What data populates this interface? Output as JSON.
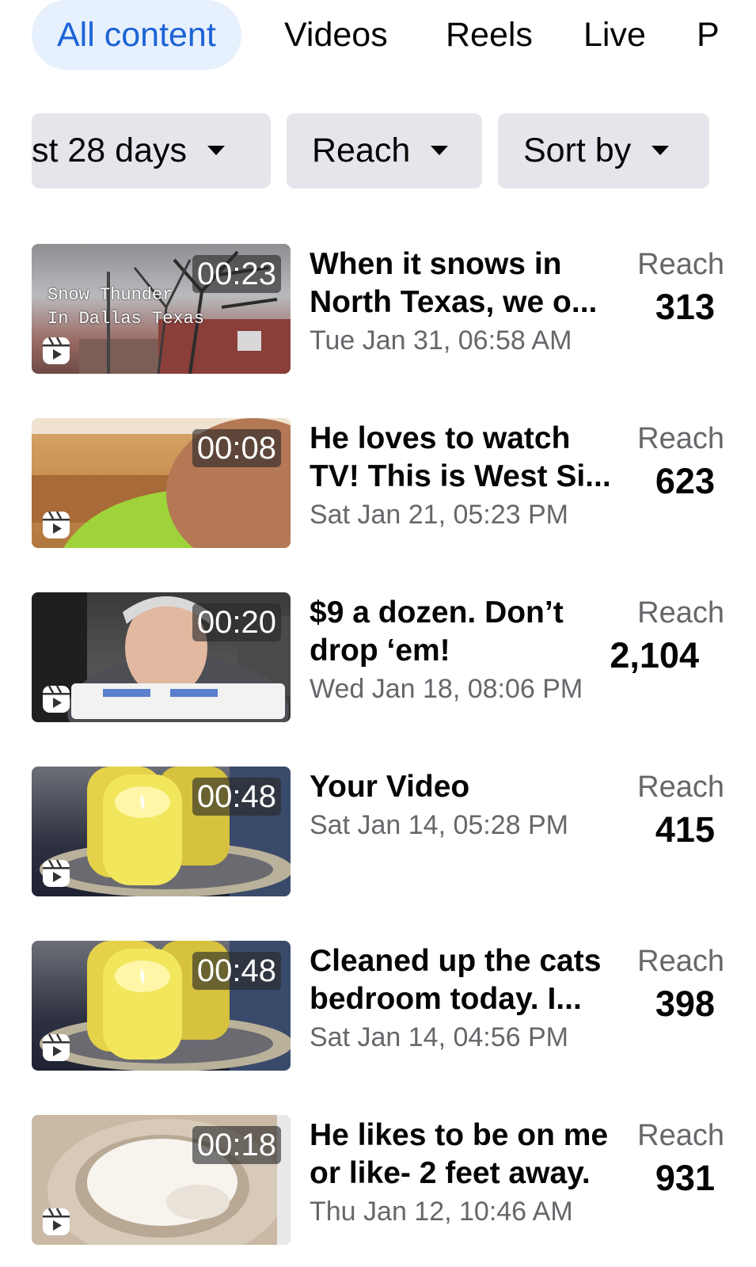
{
  "tabs": [
    {
      "label": "All content",
      "active": true
    },
    {
      "label": "Videos"
    },
    {
      "label": "Reels"
    },
    {
      "label": "Live"
    },
    {
      "label": "P"
    }
  ],
  "filters": [
    {
      "label": "st 28 days"
    },
    {
      "label": "Reach"
    },
    {
      "label": "Sort by"
    }
  ],
  "items": [
    {
      "duration": "00:23",
      "overlay": "Snow Thunder\nIn Dallas Texas",
      "title_line1": "When it snows in",
      "title_line2": "North Texas, we o...",
      "date": "Tue Jan 31, 06:58 AM",
      "metric_label": "Reach",
      "metric_value": "313"
    },
    {
      "duration": "00:08",
      "title_line1": "He loves to watch",
      "title_line2": "TV! This is West Si...",
      "date": "Sat Jan 21, 05:23 PM",
      "metric_label": "Reach",
      "metric_value": "623"
    },
    {
      "duration": "00:20",
      "title_line1": "$9 a dozen. Don’t",
      "title_line2": "drop ‘em!",
      "date": "Wed Jan 18, 08:06 PM",
      "metric_label": "Reach",
      "metric_value": "2,104"
    },
    {
      "duration": "00:48",
      "title_line1": "Your Video",
      "title_line2": "",
      "date": "Sat Jan 14, 05:28 PM",
      "metric_label": "Reach",
      "metric_value": "415"
    },
    {
      "duration": "00:48",
      "title_line1": "Cleaned up the cats",
      "title_line2": "bedroom today. I...",
      "date": "Sat Jan 14, 04:56 PM",
      "metric_label": "Reach",
      "metric_value": "398"
    },
    {
      "duration": "00:18",
      "title_line1": "He likes to be on me",
      "title_line2": "or like- 2 feet away.",
      "date": "Thu Jan 12, 10:46 AM",
      "metric_label": "Reach",
      "metric_value": "931"
    }
  ],
  "icons": {
    "reel": "reels-icon",
    "caret": "caret-down-icon"
  },
  "colors": {
    "accent": "#1b64d6",
    "active_tab_bg": "#e7f0fd",
    "chip_bg": "#e4e6eb",
    "secondary_text": "#65676b"
  }
}
